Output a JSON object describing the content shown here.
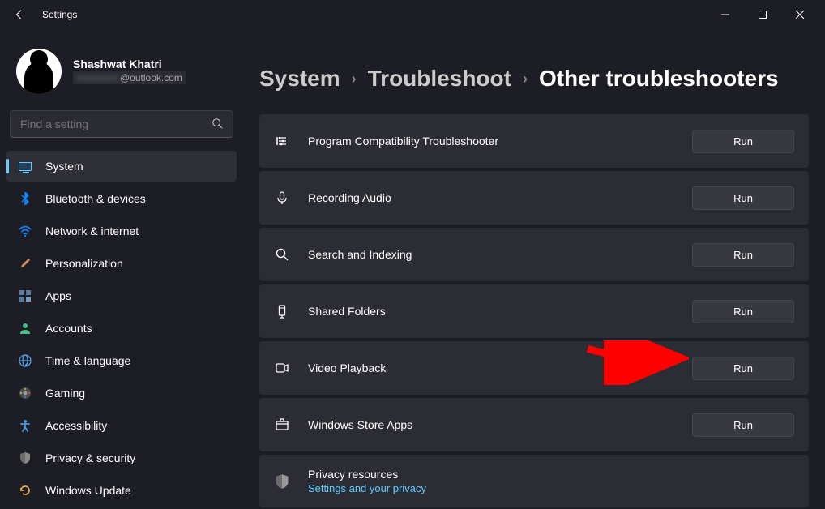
{
  "app": {
    "title": "Settings"
  },
  "profile": {
    "name": "Shashwat Khatri",
    "email_suffix": "@outlook.com"
  },
  "search": {
    "placeholder": "Find a setting"
  },
  "nav": [
    {
      "label": "System",
      "icon": "display",
      "active": true
    },
    {
      "label": "Bluetooth & devices",
      "icon": "bluetooth"
    },
    {
      "label": "Network & internet",
      "icon": "wifi"
    },
    {
      "label": "Personalization",
      "icon": "brush"
    },
    {
      "label": "Apps",
      "icon": "apps"
    },
    {
      "label": "Accounts",
      "icon": "account"
    },
    {
      "label": "Time & language",
      "icon": "globe"
    },
    {
      "label": "Gaming",
      "icon": "gaming"
    },
    {
      "label": "Accessibility",
      "icon": "accessibility"
    },
    {
      "label": "Privacy & security",
      "icon": "shield"
    },
    {
      "label": "Windows Update",
      "icon": "update"
    }
  ],
  "breadcrumb": {
    "level1": "System",
    "level2": "Troubleshoot",
    "current": "Other troubleshooters"
  },
  "troubleshooters": [
    {
      "label": "Program Compatibility Troubleshooter",
      "icon": "compat",
      "run": "Run"
    },
    {
      "label": "Recording Audio",
      "icon": "mic",
      "run": "Run"
    },
    {
      "label": "Search and Indexing",
      "icon": "search",
      "run": "Run"
    },
    {
      "label": "Shared Folders",
      "icon": "shared",
      "run": "Run"
    },
    {
      "label": "Video Playback",
      "icon": "video",
      "run": "Run"
    },
    {
      "label": "Windows Store Apps",
      "icon": "store",
      "run": "Run"
    }
  ],
  "privacy": {
    "title": "Privacy resources",
    "link": "Settings and your privacy"
  }
}
